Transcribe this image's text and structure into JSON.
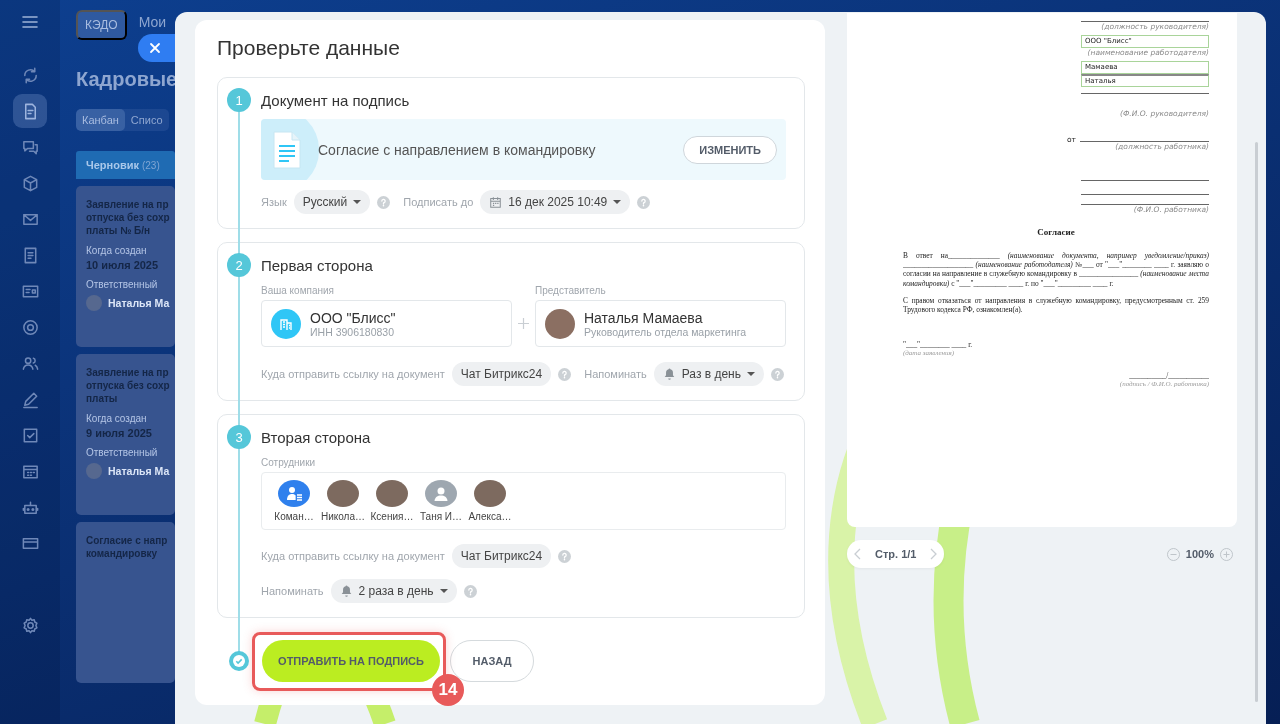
{
  "background": {
    "header": {
      "chip": "КЭДО",
      "link": "Мои"
    },
    "title": "Кадровые",
    "view_tabs": [
      {
        "label": "Канбан",
        "selected": true
      },
      {
        "label": "Списо",
        "selected": false
      }
    ],
    "column": {
      "title": "Черновик",
      "count": "(23)"
    },
    "cards": [
      {
        "title_lines": [
          "Заявление на пр",
          "отпуска без сохр",
          "платы № Б/н"
        ],
        "created_label": "Когда создан",
        "created": "10 июля 2025",
        "owner_label": "Ответственный",
        "owner": "Наталья Ма"
      },
      {
        "title_lines": [
          "Заявление на пр",
          "отпуска без сохр",
          "платы"
        ],
        "created_label": "Когда создан",
        "created": "9 июля 2025",
        "owner_label": "Ответственный",
        "owner": "Наталья Ма"
      },
      {
        "title_lines": [
          "Согласие с напр",
          "командировку"
        ]
      }
    ]
  },
  "sidebar": {
    "items": [
      {
        "selected": false
      },
      {
        "selected": true
      },
      {
        "selected": false
      },
      {
        "selected": false
      },
      {
        "selected": false
      },
      {
        "selected": false
      },
      {
        "selected": false
      },
      {
        "selected": false
      },
      {
        "selected": false
      },
      {
        "selected": false
      },
      {
        "selected": false
      },
      {
        "selected": false
      },
      {
        "selected": false
      },
      {
        "selected": false
      },
      {
        "selected": false
      }
    ]
  },
  "form": {
    "title": "Проверьте данные",
    "steps": [
      {
        "kind": "document",
        "number": "1",
        "title": "Документ на подпись",
        "document": {
          "name": "Согласие с направлением в командировку",
          "action": "ИЗМЕНИТЬ"
        },
        "language": {
          "label": "Язык",
          "value": "Русский"
        },
        "deadline": {
          "label": "Подписать до",
          "value": "16 дек 2025 10:49"
        }
      },
      {
        "kind": "first_party",
        "number": "2",
        "title": "Первая сторона",
        "company": {
          "label": "Ваша компания",
          "name": "ООО \"Блисс\"",
          "inn": "ИНН 3906180830"
        },
        "representative": {
          "label": "Представитель",
          "name": "Наталья Мамаева",
          "position": "Руководитель отдела маркетинга"
        },
        "delivery": {
          "label": "Куда отправить ссылку на документ",
          "value": "Чат Битрикс24"
        },
        "reminder": {
          "label": "Напоминать",
          "value": "Раз в день"
        }
      },
      {
        "kind": "second_party",
        "number": "3",
        "title": "Вторая сторона",
        "employees": {
          "label": "Сотрудники",
          "items": [
            {
              "name": "Коман…",
              "kind": "group"
            },
            {
              "name": "Никола…",
              "kind": "photo"
            },
            {
              "name": "Ксения…",
              "kind": "photo"
            },
            {
              "name": "Таня И…",
              "kind": "placeholder"
            },
            {
              "name": "Алекса…",
              "kind": "photo"
            }
          ]
        },
        "delivery": {
          "label": "Куда отправить ссылку на документ",
          "value": "Чат Битрикс24"
        },
        "reminder": {
          "label": "Напоминать",
          "value": "2 раза в день"
        }
      }
    ],
    "actions": [
      {
        "label": "ОТПРАВИТЬ НА ПОДПИСЬ",
        "kind": "primary"
      },
      {
        "label": "НАЗАД",
        "kind": "secondary"
      }
    ],
    "annotation": {
      "label": "14"
    }
  },
  "preview": {
    "lines": [
      {
        "kind": "caption",
        "text": "(должность руководителя)",
        "rule": true
      },
      {
        "kind": "field",
        "text": "ООО \"Блисс\""
      },
      {
        "kind": "caption",
        "text": "(наименование работодателя)",
        "rule": false
      },
      {
        "kind": "field",
        "text": "Мамаева"
      },
      {
        "kind": "field",
        "text": "Наталья"
      },
      {
        "kind": "blank"
      },
      {
        "kind": "caption",
        "text": "(Ф.И.О. руководителя)",
        "rule": false
      },
      {
        "kind": "from",
        "prefix": "от",
        "text": "(должность работника)"
      },
      {
        "kind": "blank"
      },
      {
        "kind": "blank"
      },
      {
        "kind": "caption",
        "text": "(Ф.И.О. работника)",
        "rule": true
      }
    ],
    "heading": "Согласие",
    "paragraphs": [
      "В ответ на______________ *(наименование документа, например уведомление/приказ)* ___________________ *(наименование работодателя)* №___ от \"___\"________ ____ г. заявляю о согласии на направление в служебную командировку в ________________ *(наименование места командировки)* с \"___\"_________ ____ г. по \"___\"_________ ____ г.",
      "С правом отказаться от направления в служебную командировку, предусмотренным ст. 259 Трудового кодекса РФ, ознакомлен(а)."
    ],
    "date": {
      "line": "\"___\"________ ____ г.",
      "caption": "(дата заявления)"
    },
    "signature": {
      "line": "__________/___________",
      "caption": "(подпись / Ф.И.О. работника)"
    }
  },
  "pager": {
    "label": "Стр. 1/1"
  },
  "zoom": {
    "value": "100%"
  }
}
